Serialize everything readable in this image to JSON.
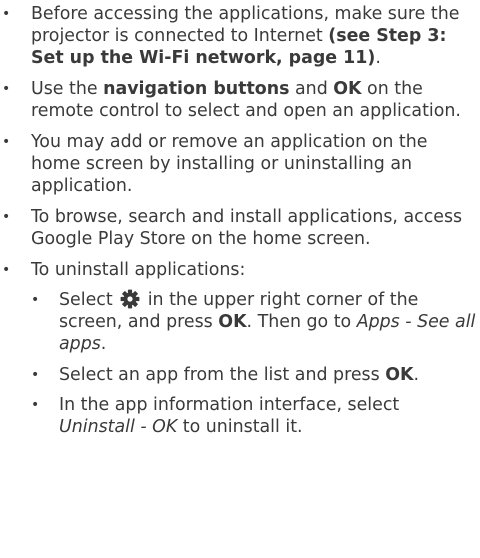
{
  "bullet": "•",
  "items": [
    {
      "pre": "Before accessing the applications, make sure the projector is connected to Internet ",
      "ref": "(see Step 3: Set up the Wi-Fi network, page 11)",
      "post": "."
    },
    {
      "pre": "Use the ",
      "bold1": "navigation buttons",
      "mid": " and ",
      "bold2": "OK",
      "post": " on the remote control to select and open an application."
    },
    {
      "text": "You may add or remove an application on the home screen by installing or uninstalling an application."
    },
    {
      "text": "To browse, search and install applications, access Google Play Store on the home screen."
    },
    {
      "text": "To uninstall applications:",
      "subitems": [
        {
          "pre": "Select ",
          "icon": "gear-icon",
          "mid": " in the upper right corner of the screen, and press ",
          "bold": "OK",
          "mid2": ". Then go to ",
          "italic": "Apps - See all apps",
          "post": "."
        },
        {
          "pre": "Select an app from the list and press ",
          "bold": "OK",
          "post": "."
        },
        {
          "pre": "In the app information interface, select ",
          "italic": "Uninstall - OK",
          "post": " to uninstall it."
        }
      ]
    }
  ]
}
